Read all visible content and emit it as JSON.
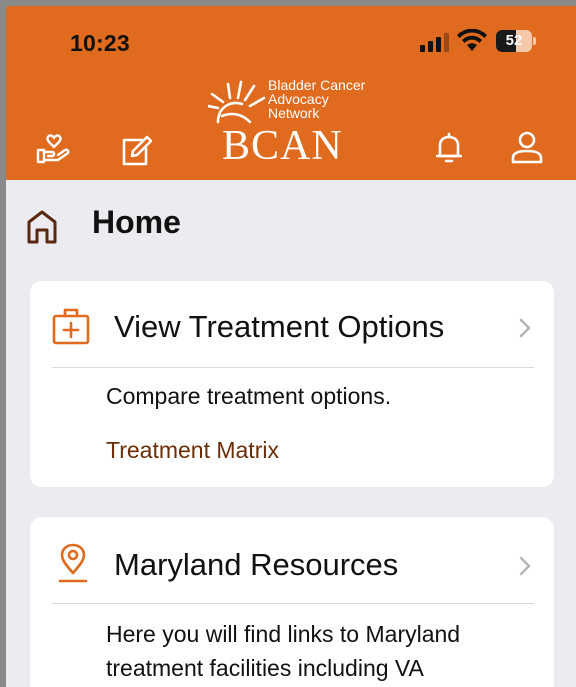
{
  "status_bar": {
    "time": "10:23",
    "battery": "52"
  },
  "header": {
    "logo_tagline": [
      "Bladder Cancer",
      "Advocacy",
      "Network"
    ],
    "logo_word": "BCAN",
    "icons": [
      "donate-icon",
      "edit-icon",
      "bell-icon",
      "profile-icon"
    ]
  },
  "page": {
    "title": "Home",
    "icon": "home-icon"
  },
  "cards": [
    {
      "icon": "medical-kit-icon",
      "title": "View Treatment Options",
      "description": "Compare treatment options.",
      "link": "Treatment Matrix"
    },
    {
      "icon": "location-pin-icon",
      "title": "Maryland Resources",
      "description": "Here you will find links to Maryland treatment facilities including VA"
    }
  ],
  "colors": {
    "brand": "#e06a1e",
    "link": "#6a2e08",
    "background": "#ebebf0"
  }
}
